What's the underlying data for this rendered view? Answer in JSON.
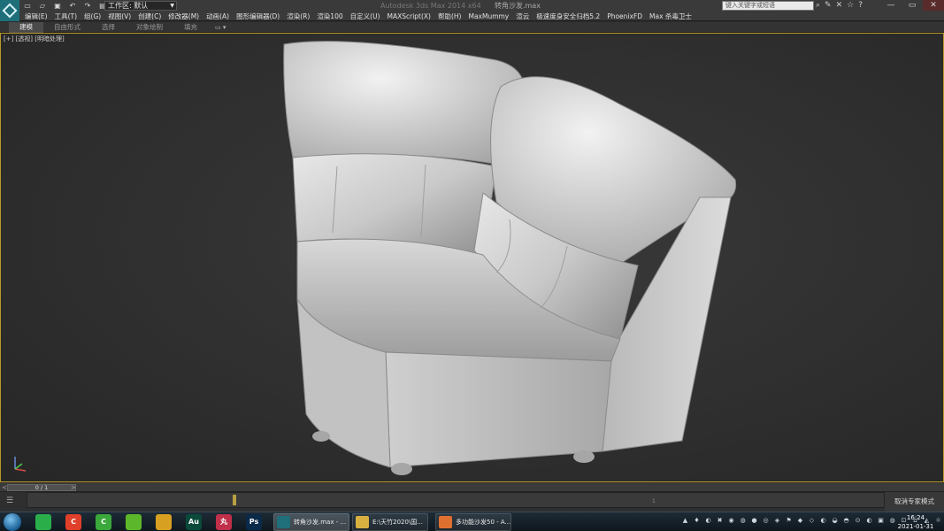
{
  "window": {
    "title": "Autodesk 3ds Max  2014 x64",
    "file": "转角沙发.max",
    "workspace": "工作区: 默认",
    "search_placeholder": "键入关键字或短语"
  },
  "menu": [
    "编辑(E)",
    "工具(T)",
    "组(G)",
    "视图(V)",
    "创建(C)",
    "修改器(M)",
    "动画(A)",
    "图形编辑器(D)",
    "渲染(R)",
    "渲染100",
    "自定义(U)",
    "MAXScript(X)",
    "帮助(H)",
    "MaxMummy",
    "渲云",
    "极速度身安全归档5.2",
    "PhoenixFD",
    "Max 杀毒卫士"
  ],
  "ribbon": {
    "tabs": [
      "建模",
      "自由形式",
      "选择",
      "对象绘制",
      "填充"
    ],
    "active_tab": "建模",
    "toggle": "▭ ▾"
  },
  "viewport": {
    "label_plus": "[+]",
    "label_view": "[透视]",
    "label_shading": "[明暗处理]"
  },
  "timeslider": {
    "frame": "0 / 1",
    "prev": "<",
    "next": ">"
  },
  "trackbar": {
    "tick_label": "1",
    "expert_mode": "取消专家模式"
  },
  "taskbar": {
    "pinned": [
      {
        "icon": "wechat-icon",
        "text": "",
        "color": "#2aae4a"
      },
      {
        "icon": "app-c-red-icon",
        "text": "C",
        "color": "#e0402a"
      },
      {
        "icon": "app-c-green-icon",
        "text": "C",
        "color": "#3aa83a"
      },
      {
        "icon": "app-green-circle-icon",
        "text": "",
        "color": "#5cb82a"
      },
      {
        "icon": "chrome-icon",
        "text": "",
        "color": "#d8a020"
      },
      {
        "icon": "audition-icon",
        "text": "Au",
        "color": "#0a4a3a"
      },
      {
        "icon": "app-wan-icon",
        "text": "丸",
        "color": "#c0304a"
      },
      {
        "icon": "photoshop-icon",
        "text": "Ps",
        "color": "#0a2a4a"
      }
    ],
    "tasks": [
      {
        "label": "转角沙发.max - ...",
        "icon_color": "#1f6f7a",
        "active": true
      },
      {
        "label": "E:\\天竹2020\\国...",
        "icon_color": "#d8b040",
        "active": false
      },
      {
        "label": "多功能沙发50 - A...",
        "icon_color": "#e07030",
        "active": false
      }
    ],
    "tray_icons": [
      "▲",
      "♦",
      "◐",
      "✖",
      "◉",
      "◍",
      "●",
      "◎",
      "◈",
      "⚑",
      "◆",
      "◇",
      "◐",
      "◒",
      "◓",
      "⊙",
      "◐",
      "▣",
      "◍",
      "⊡",
      "⌂",
      "◭",
      "☼",
      "◐",
      "▮"
    ],
    "time": "16:24",
    "date": "2021-01-31"
  },
  "colors": {
    "viewport_border": "#b89a2a",
    "accent": "#1f6f7a"
  }
}
